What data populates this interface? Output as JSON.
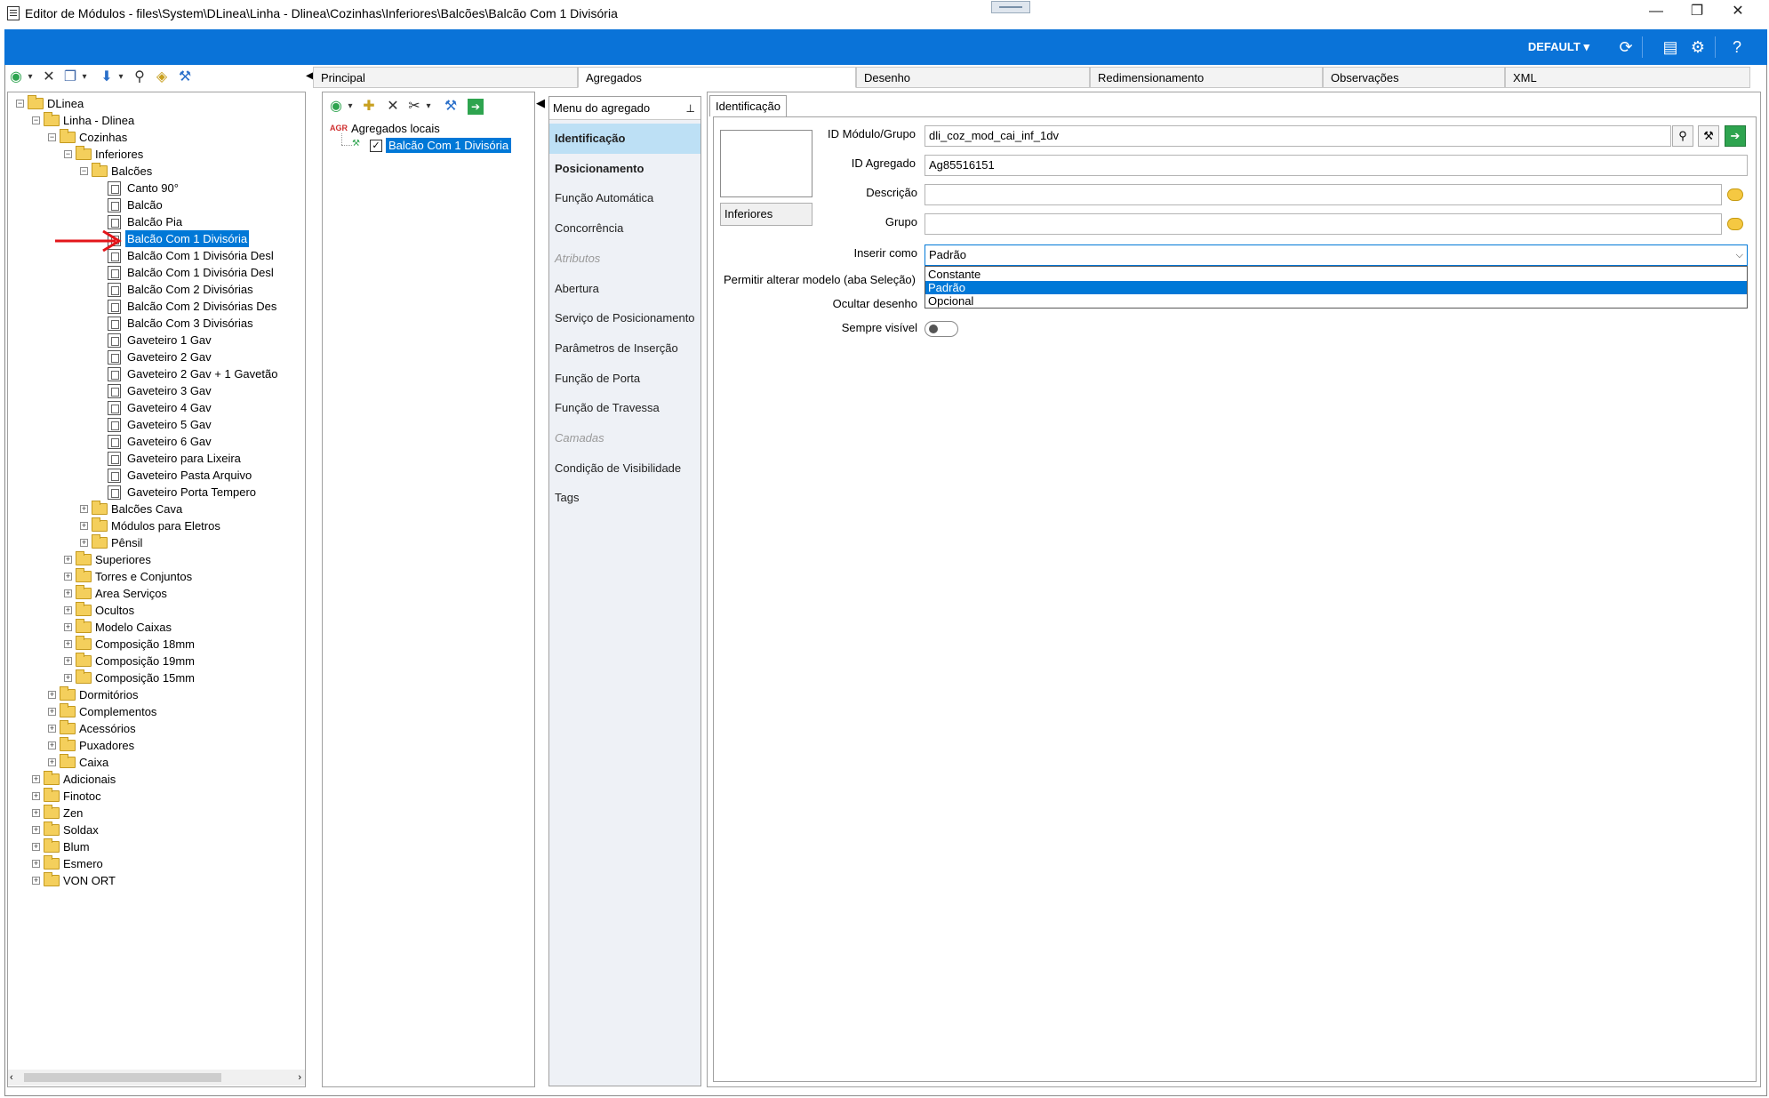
{
  "window": {
    "title": "Editor de Módulos - files\\System\\DLinea\\Linha - Dlinea\\Cozinhas\\Inferiores\\Balcões\\Balcão Com 1 Divisória",
    "minimize": "—",
    "restore": "❐",
    "close": "✕"
  },
  "ribbon": {
    "profile_label": "DEFAULT ▾",
    "accent": "#0a73d8",
    "icons": [
      "refresh-icon",
      "panel-icon",
      "settings-icon",
      "help-icon"
    ]
  },
  "tabs": [
    {
      "label": "Principal"
    },
    {
      "label": "Agregados"
    },
    {
      "label": "Desenho"
    },
    {
      "label": "Redimensionamento"
    },
    {
      "label": "Observações"
    },
    {
      "label": "XML"
    }
  ],
  "tree": {
    "nodes": [
      {
        "label": "DLinea",
        "depth": 0,
        "type": "folder",
        "exp": "−"
      },
      {
        "label": "Linha - Dlinea",
        "depth": 1,
        "type": "folder",
        "exp": "−"
      },
      {
        "label": "Cozinhas",
        "depth": 2,
        "type": "folder",
        "exp": "−"
      },
      {
        "label": "Inferiores",
        "depth": 3,
        "type": "folder",
        "exp": "−"
      },
      {
        "label": "Balcões",
        "depth": 4,
        "type": "folder",
        "exp": "−"
      },
      {
        "label": "Canto 90°",
        "depth": 5,
        "type": "doc"
      },
      {
        "label": "Balcão",
        "depth": 5,
        "type": "doc"
      },
      {
        "label": "Balcão Pia",
        "depth": 5,
        "type": "doc"
      },
      {
        "label": "Balcão Com 1 Divisória",
        "depth": 5,
        "type": "doc",
        "selected": true
      },
      {
        "label": "Balcão Com 1 Divisória Desl",
        "depth": 5,
        "type": "doc"
      },
      {
        "label": "Balcão Com 1 Divisória Desl",
        "depth": 5,
        "type": "doc"
      },
      {
        "label": "Balcão Com 2 Divisórias",
        "depth": 5,
        "type": "doc"
      },
      {
        "label": "Balcão Com 2 Divisórias Des",
        "depth": 5,
        "type": "doc"
      },
      {
        "label": "Balcão Com 3 Divisórias",
        "depth": 5,
        "type": "doc"
      },
      {
        "label": "Gaveteiro 1 Gav",
        "depth": 5,
        "type": "doc"
      },
      {
        "label": "Gaveteiro 2 Gav",
        "depth": 5,
        "type": "doc"
      },
      {
        "label": "Gaveteiro 2 Gav + 1 Gavetão",
        "depth": 5,
        "type": "doc"
      },
      {
        "label": "Gaveteiro 3 Gav",
        "depth": 5,
        "type": "doc"
      },
      {
        "label": "Gaveteiro 4 Gav",
        "depth": 5,
        "type": "doc"
      },
      {
        "label": "Gaveteiro 5 Gav",
        "depth": 5,
        "type": "doc"
      },
      {
        "label": "Gaveteiro 6 Gav",
        "depth": 5,
        "type": "doc"
      },
      {
        "label": "Gaveteiro para Lixeira",
        "depth": 5,
        "type": "doc"
      },
      {
        "label": "Gaveteiro Pasta Arquivo",
        "depth": 5,
        "type": "doc"
      },
      {
        "label": "Gaveteiro Porta Tempero",
        "depth": 5,
        "type": "doc"
      },
      {
        "label": "Balcões Cava",
        "depth": 4,
        "type": "folder",
        "exp": "+"
      },
      {
        "label": "Módulos para Eletros",
        "depth": 4,
        "type": "folder",
        "exp": "+"
      },
      {
        "label": "Pênsil",
        "depth": 4,
        "type": "folder",
        "exp": "+"
      },
      {
        "label": "Superiores",
        "depth": 3,
        "type": "folder",
        "exp": "+"
      },
      {
        "label": "Torres e Conjuntos",
        "depth": 3,
        "type": "folder",
        "exp": "+"
      },
      {
        "label": "Area Serviços",
        "depth": 3,
        "type": "folder",
        "exp": "+"
      },
      {
        "label": "Ocultos",
        "depth": 3,
        "type": "folder",
        "exp": "+"
      },
      {
        "label": "Modelo Caixas",
        "depth": 3,
        "type": "folder",
        "exp": "+"
      },
      {
        "label": "Composição 18mm",
        "depth": 3,
        "type": "folder",
        "exp": "+"
      },
      {
        "label": "Composição 19mm",
        "depth": 3,
        "type": "folder",
        "exp": "+"
      },
      {
        "label": "Composição 15mm",
        "depth": 3,
        "type": "folder",
        "exp": "+"
      },
      {
        "label": "Dormitórios",
        "depth": 2,
        "type": "folder",
        "exp": "+"
      },
      {
        "label": "Complementos",
        "depth": 2,
        "type": "folder",
        "exp": "+"
      },
      {
        "label": "Acessórios",
        "depth": 2,
        "type": "folder",
        "exp": "+"
      },
      {
        "label": "Puxadores",
        "depth": 2,
        "type": "folder",
        "exp": "+"
      },
      {
        "label": "Caixa",
        "depth": 2,
        "type": "folder",
        "exp": "+"
      },
      {
        "label": "Adicionais",
        "depth": 1,
        "type": "folder",
        "exp": "+"
      },
      {
        "label": "Finotoc",
        "depth": 1,
        "type": "folder",
        "exp": "+"
      },
      {
        "label": "Zen",
        "depth": 1,
        "type": "folder",
        "exp": "+"
      },
      {
        "label": "Soldax",
        "depth": 1,
        "type": "folder",
        "exp": "+"
      },
      {
        "label": "Blum",
        "depth": 1,
        "type": "folder",
        "exp": "+"
      },
      {
        "label": "Esmero",
        "depth": 1,
        "type": "folder",
        "exp": "+"
      },
      {
        "label": "VON ORT",
        "depth": 1,
        "type": "folder",
        "exp": "+"
      }
    ]
  },
  "aggregates": {
    "root_badge": "AGR",
    "root_label": "Agregados locais",
    "child_label": "Balcão Com 1 Divisória"
  },
  "menu": {
    "header": "Menu do agregado",
    "items": [
      {
        "label": "Identificação",
        "state": "selected"
      },
      {
        "label": "Posicionamento",
        "state": "bold"
      },
      {
        "label": "Função Automática",
        "state": "normal"
      },
      {
        "label": "Concorrência",
        "state": "normal"
      },
      {
        "label": "Atributos",
        "state": "disabled"
      },
      {
        "label": "Abertura",
        "state": "normal"
      },
      {
        "label": "Serviço de Posicionamento",
        "state": "normal"
      },
      {
        "label": "Parâmetros de Inserção",
        "state": "normal"
      },
      {
        "label": "Função de Porta",
        "state": "normal"
      },
      {
        "label": "Função de Travessa",
        "state": "normal"
      },
      {
        "label": "Camadas",
        "state": "disabled"
      },
      {
        "label": "Condição de Visibilidade",
        "state": "normal"
      },
      {
        "label": "Tags",
        "state": "normal"
      }
    ]
  },
  "form": {
    "tab_label": "Identificação",
    "category_button": "Inferiores",
    "id_modulo_label": "ID Módulo/Grupo",
    "id_modulo_value": "dli_coz_mod_cai_inf_1dv",
    "id_agregado_label": "ID Agregado",
    "id_agregado_value": "Ag85516151",
    "descricao_label": "Descrição",
    "descricao_value": "",
    "grupo_label": "Grupo",
    "grupo_value": "",
    "inserir_label": "Inserir como",
    "inserir_value": "Padrão",
    "inserir_options": [
      "Constante",
      "Padrão",
      "Opcional"
    ],
    "inserir_selected_index": 1,
    "permitir_label": "Permitir alterar modelo (aba Seleção)",
    "ocultar_label": "Ocultar desenho",
    "sempre_label": "Sempre visível",
    "sempre_value": false
  }
}
